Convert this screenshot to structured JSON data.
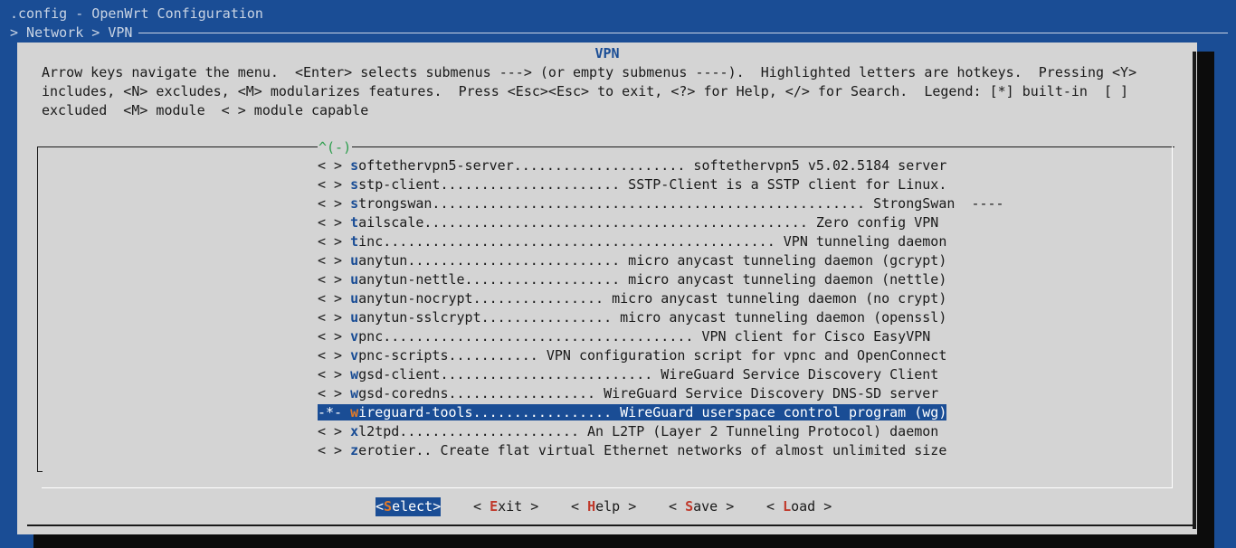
{
  "window": {
    "title": ".config - OpenWrt Configuration",
    "breadcrumb": "> Network > VPN"
  },
  "dialog": {
    "title": "VPN",
    "help_lines": [
      "Arrow keys navigate the menu.  <Enter> selects submenus ---> (or empty submenus ----).  Highlighted letters are hotkeys.  Pressing <Y>",
      "includes, <N> excludes, <M> modularizes features.  Press <Esc><Esc> to exit, <?> for Help, </> for Search.  Legend: [*] built-in  [ ]",
      "excluded  <M> module  < > module capable"
    ],
    "scroll_indicator": "^(-)"
  },
  "menu": {
    "items": [
      {
        "state": "< >",
        "hotkey": "s",
        "rest": "oftethervpn5-server..................... softethervpn5 v5.02.5184 server"
      },
      {
        "state": "< >",
        "hotkey": "s",
        "rest": "stp-client...................... SSTP-Client is a SSTP client for Linux."
      },
      {
        "state": "< >",
        "hotkey": "s",
        "rest": "trongswan..................................................... StrongSwan  ----"
      },
      {
        "state": "< >",
        "hotkey": "t",
        "rest": "ailscale............................................... Zero config VPN"
      },
      {
        "state": "< >",
        "hotkey": "t",
        "rest": "inc................................................ VPN tunneling daemon"
      },
      {
        "state": "< >",
        "hotkey": "u",
        "rest": "anytun.......................... micro anycast tunneling daemon (gcrypt)"
      },
      {
        "state": "< >",
        "hotkey": "u",
        "rest": "anytun-nettle................... micro anycast tunneling daemon (nettle)"
      },
      {
        "state": "< >",
        "hotkey": "u",
        "rest": "anytun-nocrypt................ micro anycast tunneling daemon (no crypt)"
      },
      {
        "state": "< >",
        "hotkey": "u",
        "rest": "anytun-sslcrypt................ micro anycast tunneling daemon (openssl)"
      },
      {
        "state": "< >",
        "hotkey": "v",
        "rest": "pnc...................................... VPN client for Cisco EasyVPN"
      },
      {
        "state": "< >",
        "hotkey": "v",
        "rest": "pnc-scripts........... VPN configuration script for vpnc and OpenConnect"
      },
      {
        "state": "< >",
        "hotkey": "w",
        "rest": "gsd-client.......................... WireGuard Service Discovery Client"
      },
      {
        "state": "< >",
        "hotkey": "w",
        "rest": "gsd-coredns.................. WireGuard Service Discovery DNS-SD server"
      },
      {
        "state": "-*-",
        "hotkey": "w",
        "rest": "ireguard-tools................. WireGuard userspace control program (wg)"
      },
      {
        "state": "< >",
        "hotkey": "x",
        "rest": "l2tpd...................... An L2TP (Layer 2 Tunneling Protocol) daemon"
      },
      {
        "state": "< >",
        "hotkey": "z",
        "rest": "erotier.. Create flat virtual Ethernet networks of almost unlimited size"
      }
    ]
  },
  "buttons": [
    {
      "pre": "<",
      "hotkey": "S",
      "post": "elect>"
    },
    {
      "pre": "< ",
      "hotkey": "E",
      "post": "xit >"
    },
    {
      "pre": "< ",
      "hotkey": "H",
      "post": "elp >"
    },
    {
      "pre": "< ",
      "hotkey": "S",
      "post": "ave >"
    },
    {
      "pre": "< ",
      "hotkey": "L",
      "post": "oad >"
    }
  ],
  "colors": {
    "background": "#1a4d95",
    "dialog": "#d4d4d4",
    "hotkey_menu": "#1a4d95",
    "hotkey_button": "#c0392b",
    "hotkey_selected": "#e07a2a",
    "scroll_indicator": "#2a9d4a"
  }
}
